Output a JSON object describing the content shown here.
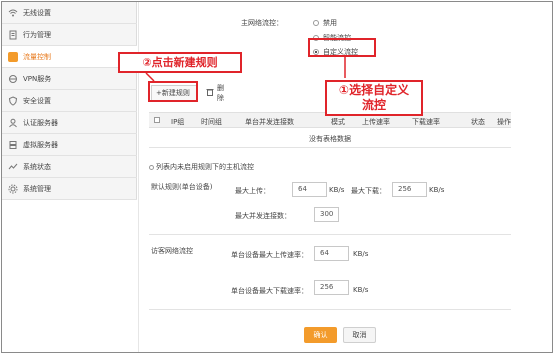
{
  "sidebar": {
    "items": [
      {
        "label": "无线设置",
        "icon": "wifi-icon"
      },
      {
        "label": "行为管理",
        "icon": "behavior-icon"
      },
      {
        "label": "流量控制",
        "icon": "traffic-icon",
        "active": true
      },
      {
        "label": "VPN服务",
        "icon": "vpn-icon"
      },
      {
        "label": "安全设置",
        "icon": "security-icon"
      },
      {
        "label": "认证服务器",
        "icon": "auth-icon"
      },
      {
        "label": "虚拟服务器",
        "icon": "virtual-server-icon"
      },
      {
        "label": "系统状态",
        "icon": "status-icon"
      },
      {
        "label": "系统管理",
        "icon": "system-icon"
      }
    ]
  },
  "main": {
    "flow_control_label": "主网络流控：",
    "options": [
      "禁用",
      "智能流控",
      "自定义流控"
    ],
    "selected_option": "自定义流控",
    "new_rule_button": "+新建规则",
    "delete_button": "删除",
    "table": {
      "headers": [
        "IP组",
        "时间组",
        "单台并发连接数",
        "模式",
        "上传速率",
        "下载速率",
        "状态",
        "操作"
      ],
      "empty_text": "没有表格数据"
    },
    "note": "列表内未启用规则下的主机流控",
    "default_rule_label": "默认规则(单台设备)",
    "max_upload_label": "最大上传：",
    "max_upload_value": "64",
    "max_upload_unit": "KB/s",
    "max_download_label": "最大下载：",
    "max_download_value": "256",
    "max_download_unit": "KB/s",
    "max_conn_label": "最大并发连接数：",
    "max_conn_value": "300",
    "guest_label": "访客网络流控",
    "guest_upload_label": "单台设备最大上传速率：",
    "guest_upload_value": "64",
    "guest_upload_unit": "KB/s",
    "guest_download_label": "单台设备最大下载速率：",
    "guest_download_value": "256",
    "guest_download_unit": "KB/s",
    "confirm_button": "确认",
    "cancel_button": "取消"
  },
  "annotations": {
    "step2": "②点击新建规则",
    "step1_line1": "①选择自定义",
    "step1_line2": "流控"
  },
  "colors": {
    "accent": "#f39b2b",
    "annotation_red": "#e0242a"
  }
}
